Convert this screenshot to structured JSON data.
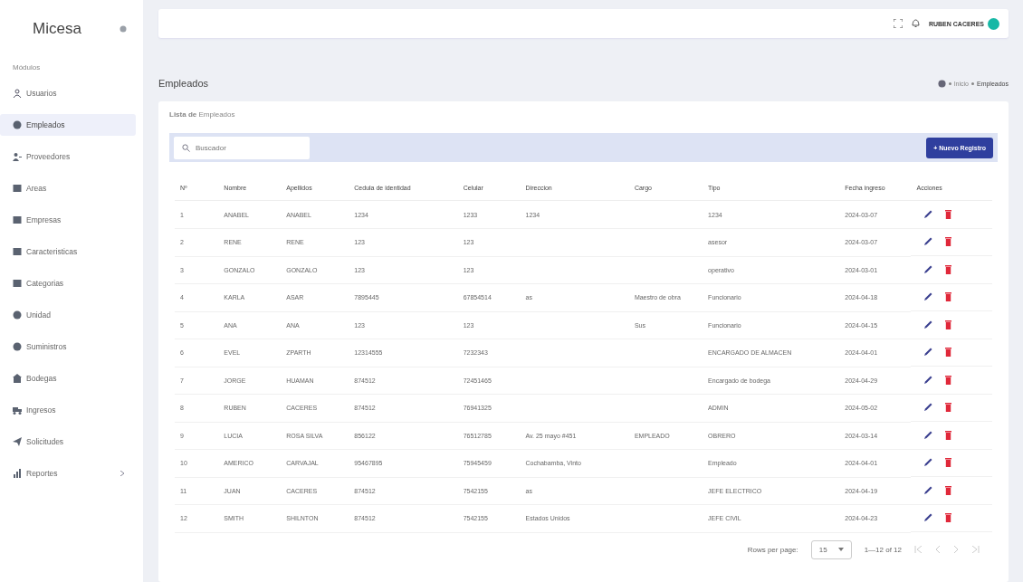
{
  "sidebar": {
    "brand": "Micesa",
    "section": "Módulos",
    "items": [
      {
        "label": "Usuarios",
        "selected": false,
        "expandable": false
      },
      {
        "label": "Empleados",
        "selected": true,
        "expandable": false
      },
      {
        "label": "Proveedores",
        "selected": false,
        "expandable": false
      },
      {
        "label": "Areas",
        "selected": false,
        "expandable": false
      },
      {
        "label": "Empresas",
        "selected": false,
        "expandable": false
      },
      {
        "label": "Caracteristicas",
        "selected": false,
        "expandable": false
      },
      {
        "label": "Categorias",
        "selected": false,
        "expandable": false
      },
      {
        "label": "Unidad",
        "selected": false,
        "expandable": false
      },
      {
        "label": "Suministros",
        "selected": false,
        "expandable": false
      },
      {
        "label": "Bodegas",
        "selected": false,
        "expandable": false
      },
      {
        "label": "Ingresos",
        "selected": false,
        "expandable": false
      },
      {
        "label": "Solicitudes",
        "selected": false,
        "expandable": false
      },
      {
        "label": "Reportes",
        "selected": false,
        "expandable": true
      }
    ]
  },
  "topbar": {
    "user": "RUBEN CACERES"
  },
  "page": {
    "title": "Empleados",
    "breadcrumb": [
      "Inicio",
      "Empleados"
    ]
  },
  "card": {
    "title": "**Lista de** Empleados",
    "search": {
      "placeholder": "Buscador"
    },
    "new_button": "+ Nuevo Registro"
  },
  "table": {
    "columns": [
      "Nº",
      "Nombre",
      "Apellidos",
      "Cedula de identidad",
      "Celular",
      "Direccion",
      "Cargo",
      "Tipo",
      "Fecha ingreso",
      "Acciones"
    ],
    "rows": [
      [
        "1",
        "ANABEL",
        "ANABEL",
        "1234",
        "1233",
        "1234",
        "",
        "1234",
        "2024-03-07"
      ],
      [
        "2",
        "RENE",
        "RENE",
        "123",
        "123",
        "",
        "",
        "asesor",
        "2024-03-07"
      ],
      [
        "3",
        "GONZALO",
        "GONZALO",
        "123",
        "123",
        "",
        "",
        "operativo",
        "2024-03-01"
      ],
      [
        "4",
        "KARLA",
        "ASAR",
        "7895445",
        "67854514",
        "as",
        "Maestro de obra",
        "Funcionario",
        "2024-04-18"
      ],
      [
        "5",
        "ANA",
        "ANA",
        "123",
        "123",
        "",
        "Sus",
        "Funcionario",
        "2024-04-15"
      ],
      [
        "6",
        "EVEL",
        "ZPARTH",
        "12314555",
        "7232343",
        "",
        "",
        "ENCARGADO DE ALMACEN",
        "2024-04-01"
      ],
      [
        "7",
        "JORGE",
        "HUAMAN",
        "874512",
        "72451465",
        "",
        "",
        "Encargado de bodega",
        "2024-04-29"
      ],
      [
        "8",
        "RUBEN",
        "CACERES",
        "874512",
        "76941325",
        "",
        "",
        "ADMIN",
        "2024-05-02"
      ],
      [
        "9",
        "LUCIA",
        "ROSA SILVA",
        "856122",
        "76512785",
        "Av. 25 mayo #451",
        "EMPLEADO",
        "OBRERO",
        "2024-03-14"
      ],
      [
        "10",
        "AMERICO",
        "CARVAJAL",
        "95467895",
        "75945459",
        "Cochabamba, Vinto",
        "",
        "Empleado",
        "2024-04-01"
      ],
      [
        "11",
        "JUAN",
        "CACERES",
        "874512",
        "7542155",
        "as",
        "",
        "JEFE ELECTRICO",
        "2024-04-19"
      ],
      [
        "12",
        "SMITH",
        "SHILNTON",
        "874512",
        "7542155",
        "Estados Unidos",
        "",
        "JEFE CIVIL",
        "2024-04-23"
      ]
    ]
  },
  "pagination": {
    "rows_label": "Rows per page:",
    "rows_value": "15",
    "range": "1—12 of 12"
  }
}
